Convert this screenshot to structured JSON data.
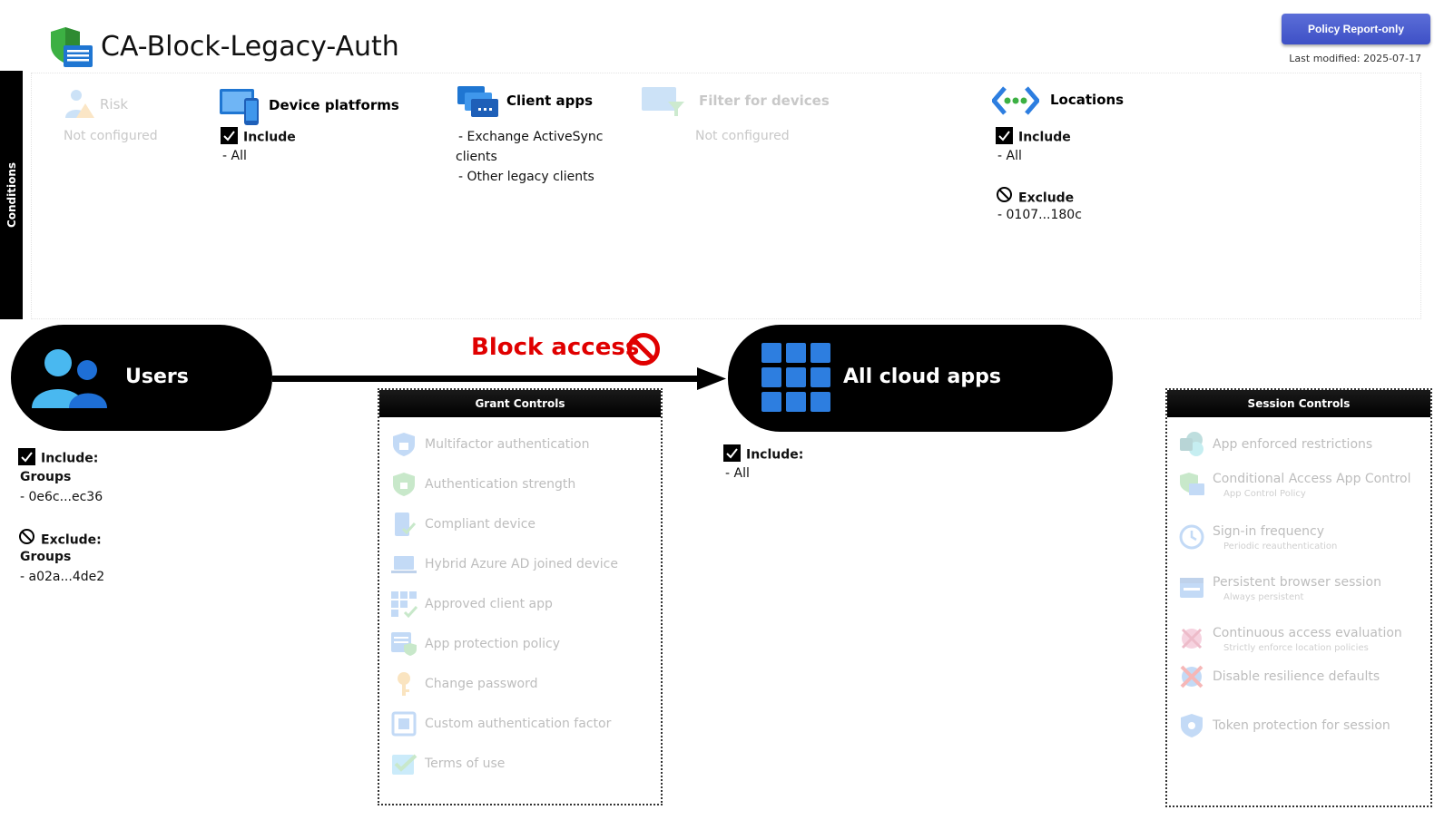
{
  "header": {
    "title": "CA-Block-Legacy-Auth",
    "report_button": "Policy Report-only",
    "last_modified": "Last modified: 2025-07-17"
  },
  "conditions": {
    "tab_label": "Conditions",
    "risk": {
      "title": "Risk",
      "value": "Not configured"
    },
    "device_platforms": {
      "title": "Device platforms",
      "include_label": "Include",
      "include_value": "- All"
    },
    "client_apps": {
      "title": "Client apps",
      "items": [
        "- Exchange ActiveSync",
        "clients",
        "- Other legacy clients"
      ]
    },
    "filter_devices": {
      "title": "Filter for devices",
      "value": "Not configured"
    },
    "locations": {
      "title": "Locations",
      "include_label": "Include",
      "include_value": "- All",
      "exclude_label": "Exclude",
      "exclude_value": "- 0107...180c"
    }
  },
  "users": {
    "label": "Users",
    "include_label": "Include:",
    "include_type": "Groups",
    "include_value": "- 0e6c...ec36",
    "exclude_label": "Exclude:",
    "exclude_type": "Groups",
    "exclude_value": "- a02a...4de2"
  },
  "action": {
    "label": "Block access",
    "color": "#e00000"
  },
  "cloud_apps": {
    "label": "All cloud apps",
    "include_label": "Include:",
    "include_value": "- All"
  },
  "grant_controls": {
    "title": "Grant Controls",
    "items": [
      "Multifactor authentication",
      "Authentication strength",
      "Compliant device",
      "Hybrid Azure AD joined device",
      "Approved client app",
      "App protection policy",
      "Change password",
      "Custom authentication factor",
      "Terms of use"
    ]
  },
  "session_controls": {
    "title": "Session Controls",
    "items": [
      {
        "label": "App enforced restrictions",
        "sub": ""
      },
      {
        "label": "Conditional Access App Control",
        "sub": "App Control Policy"
      },
      {
        "label": "Sign-in frequency",
        "sub": "Periodic reauthentication"
      },
      {
        "label": "Persistent browser session",
        "sub": "Always persistent"
      },
      {
        "label": "Continuous access evaluation",
        "sub": "Strictly enforce location policies"
      },
      {
        "label": "Disable resilience defaults",
        "sub": ""
      },
      {
        "label": "Token protection for session",
        "sub": ""
      }
    ]
  },
  "colors": {
    "accent_blue": "#2d7ee0",
    "report_button": "#4a5dd0",
    "block_red": "#e00000"
  }
}
